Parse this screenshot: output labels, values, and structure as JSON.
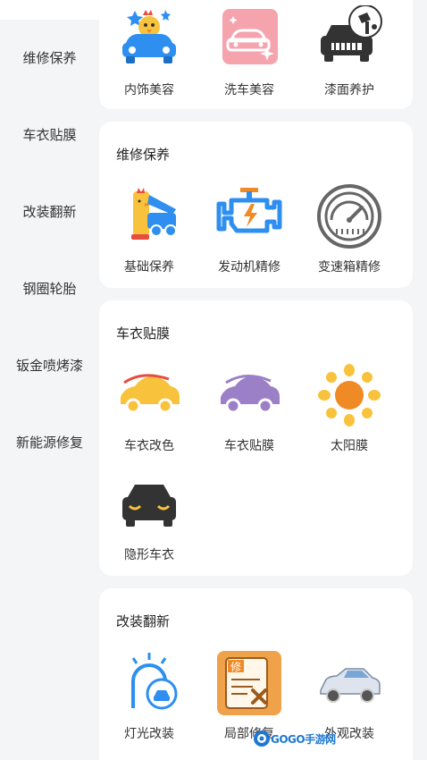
{
  "sidebar": {
    "items": [
      {
        "label": "维修保养"
      },
      {
        "label": "车衣贴膜"
      },
      {
        "label": "改装翻新"
      },
      {
        "label": "钢圈轮胎"
      },
      {
        "label": "钣金喷烤漆"
      },
      {
        "label": "新能源修复"
      }
    ]
  },
  "sections": [
    {
      "title": "",
      "items": [
        {
          "label": "内饰美容",
          "icon": "car-chick-icon"
        },
        {
          "label": "洗车美容",
          "icon": "car-wash-sparkle-icon"
        },
        {
          "label": "漆面养护",
          "icon": "car-paint-care-icon"
        }
      ]
    },
    {
      "title": "维修保养",
      "items": [
        {
          "label": "基础保养",
          "icon": "car-hood-chick-icon"
        },
        {
          "label": "发动机精修",
          "icon": "engine-icon"
        },
        {
          "label": "变速箱精修",
          "icon": "gauge-icon"
        }
      ]
    },
    {
      "title": "车衣贴膜",
      "items": [
        {
          "label": "车衣改色",
          "icon": "yellow-car-icon"
        },
        {
          "label": "车衣贴膜",
          "icon": "purple-car-icon"
        },
        {
          "label": "太阳膜",
          "icon": "sun-icon"
        },
        {
          "label": "隐形车衣",
          "icon": "car-front-icon"
        }
      ]
    },
    {
      "title": "改装翻新",
      "items": [
        {
          "label": "灯光改装",
          "icon": "car-light-icon"
        },
        {
          "label": "局部修复",
          "icon": "repair-document-icon"
        },
        {
          "label": "外观改装",
          "icon": "silver-car-icon"
        }
      ]
    }
  ],
  "watermark": {
    "text": "GOGO手游网"
  },
  "colors": {
    "background": "#f4f5f7",
    "card": "#ffffff",
    "accent_blue": "#2e8ff0",
    "yellow": "#f9c23c"
  }
}
